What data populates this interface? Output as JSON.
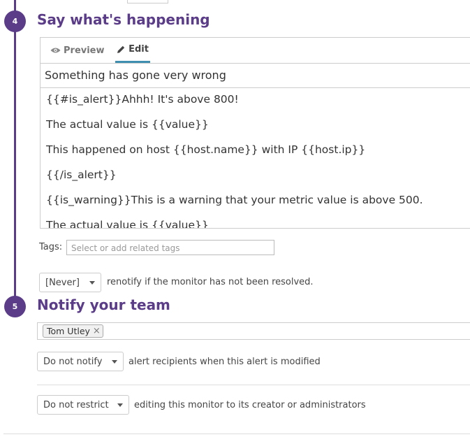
{
  "steps": {
    "step4": {
      "number": "4",
      "title": "Say what's happening",
      "tabs": {
        "preview": "Preview",
        "edit": "Edit"
      },
      "message_title": "Something has gone very wrong",
      "body_lines": [
        "{{#is_alert}}Ahhh! It's above 800!",
        "The actual value is {{value}}",
        "This happened on host {{host.name}} with IP {{host.ip}}",
        "{{/is_alert}}",
        "{{is_warning}}This is a warning that your metric value is above 500.",
        "The actual value is {{value}}"
      ],
      "tags_label": "Tags:",
      "tags_placeholder": "Select or add related tags",
      "renotify_select": "[Never]",
      "renotify_text": "renotify if the monitor has not been resolved."
    },
    "step5": {
      "number": "5",
      "title": "Notify your team",
      "recipient": "Tom Utley",
      "notify_select": "Do not notify",
      "notify_text": "alert recipients when this alert is modified",
      "restrict_select": "Do not restrict",
      "restrict_text": "editing this monitor to its creator or administrators"
    }
  },
  "colors": {
    "accent": "#5b3c88",
    "tab_underline": "#3e8fb0"
  },
  "icons": {
    "preview": "eye-icon",
    "edit": "pencil-icon",
    "remove": "close-icon",
    "dropdown": "caret-down-icon"
  }
}
